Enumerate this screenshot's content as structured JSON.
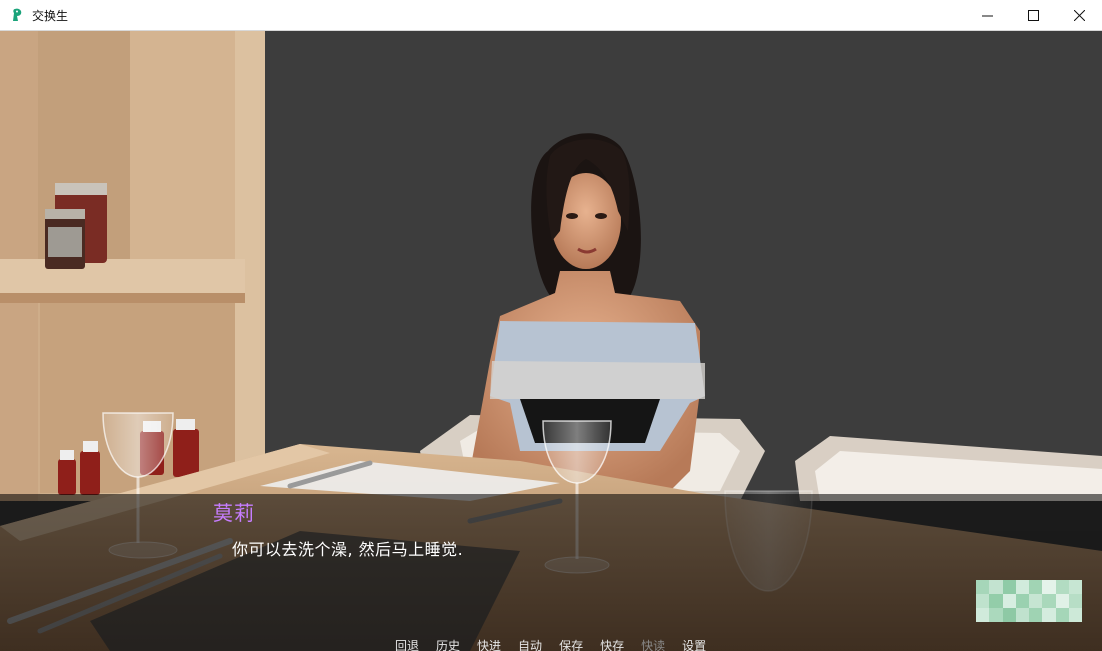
{
  "window": {
    "title": "交换生",
    "icon": "renpy-icon",
    "controls": [
      "minimize-icon",
      "maximize-icon",
      "close-icon"
    ]
  },
  "dialogue": {
    "speaker": "莫莉",
    "speaker_color": "#c77dff",
    "text": "你可以去洗个澡, 然后马上睡觉."
  },
  "quick_menu": {
    "rollback": "回退",
    "history": "历史",
    "skip": "快进",
    "auto": "自动",
    "save": "保存",
    "quick_save": "快存",
    "quick_load": "快读",
    "prefs": "设置"
  }
}
